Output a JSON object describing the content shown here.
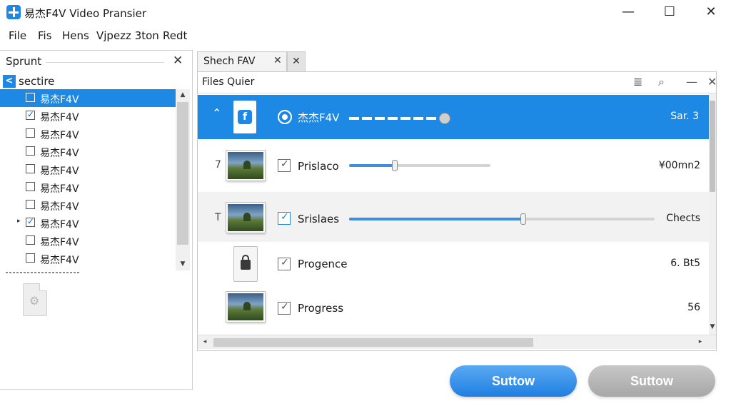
{
  "window": {
    "title": "易杰F4V Video Pransier",
    "minimize": "—",
    "maximize": "☐",
    "close": "✕"
  },
  "menu": [
    "File",
    "Fis",
    "Hens",
    "Vjpezz 3ton",
    "Redt"
  ],
  "left_panel": {
    "header": "Sprunt",
    "close": "✕",
    "collapse": "<",
    "section": "sectire",
    "items": [
      {
        "label": "易杰F4V",
        "checked": false,
        "selected": true
      },
      {
        "label": "易杰F4V",
        "checked": true,
        "selected": false
      },
      {
        "label": "易杰F4V",
        "checked": false,
        "selected": false
      },
      {
        "label": "易杰F4V",
        "checked": false,
        "selected": false
      },
      {
        "label": "易杰F4V",
        "checked": false,
        "selected": false
      },
      {
        "label": "易杰F4V",
        "checked": false,
        "selected": false
      },
      {
        "label": "易杰F4V",
        "checked": false,
        "selected": false
      },
      {
        "label": "易杰F4V",
        "checked": true,
        "selected": false
      },
      {
        "label": "易杰F4V",
        "checked": false,
        "selected": false
      },
      {
        "label": "易杰F4V",
        "checked": false,
        "selected": false
      }
    ]
  },
  "tab": {
    "label": "Shech FAV",
    "close": "✕",
    "extra_close": "✕"
  },
  "right_panel": {
    "title": "Files Quier",
    "tools": [
      "≣",
      "⌕",
      "—",
      "✕"
    ],
    "header_row": {
      "label": "杰杰F4V",
      "value": "Sar. 3",
      "icon": "f",
      "progress": 1.0
    },
    "rows": [
      {
        "num": "7",
        "label": "Prislaco",
        "value": "¥00mn2",
        "checked": true,
        "progress": 0.31,
        "icon": "thumbnail"
      },
      {
        "num": "T",
        "label": "Srislaes",
        "value": "Chects",
        "checked": true,
        "progress": 0.57,
        "icon": "thumbnail"
      },
      {
        "num": "",
        "label": "Progence",
        "value": "6. Bt5",
        "checked": true,
        "progress": null,
        "icon": "locked-file"
      },
      {
        "num": "",
        "label": "Progress",
        "value": "56",
        "checked": true,
        "progress": null,
        "icon": "thumbnail"
      }
    ]
  },
  "buttons": {
    "primary": "Suttow",
    "secondary": "Suttow"
  },
  "colors": {
    "accent": "#1e88e5",
    "selection": "#1e88e5"
  }
}
